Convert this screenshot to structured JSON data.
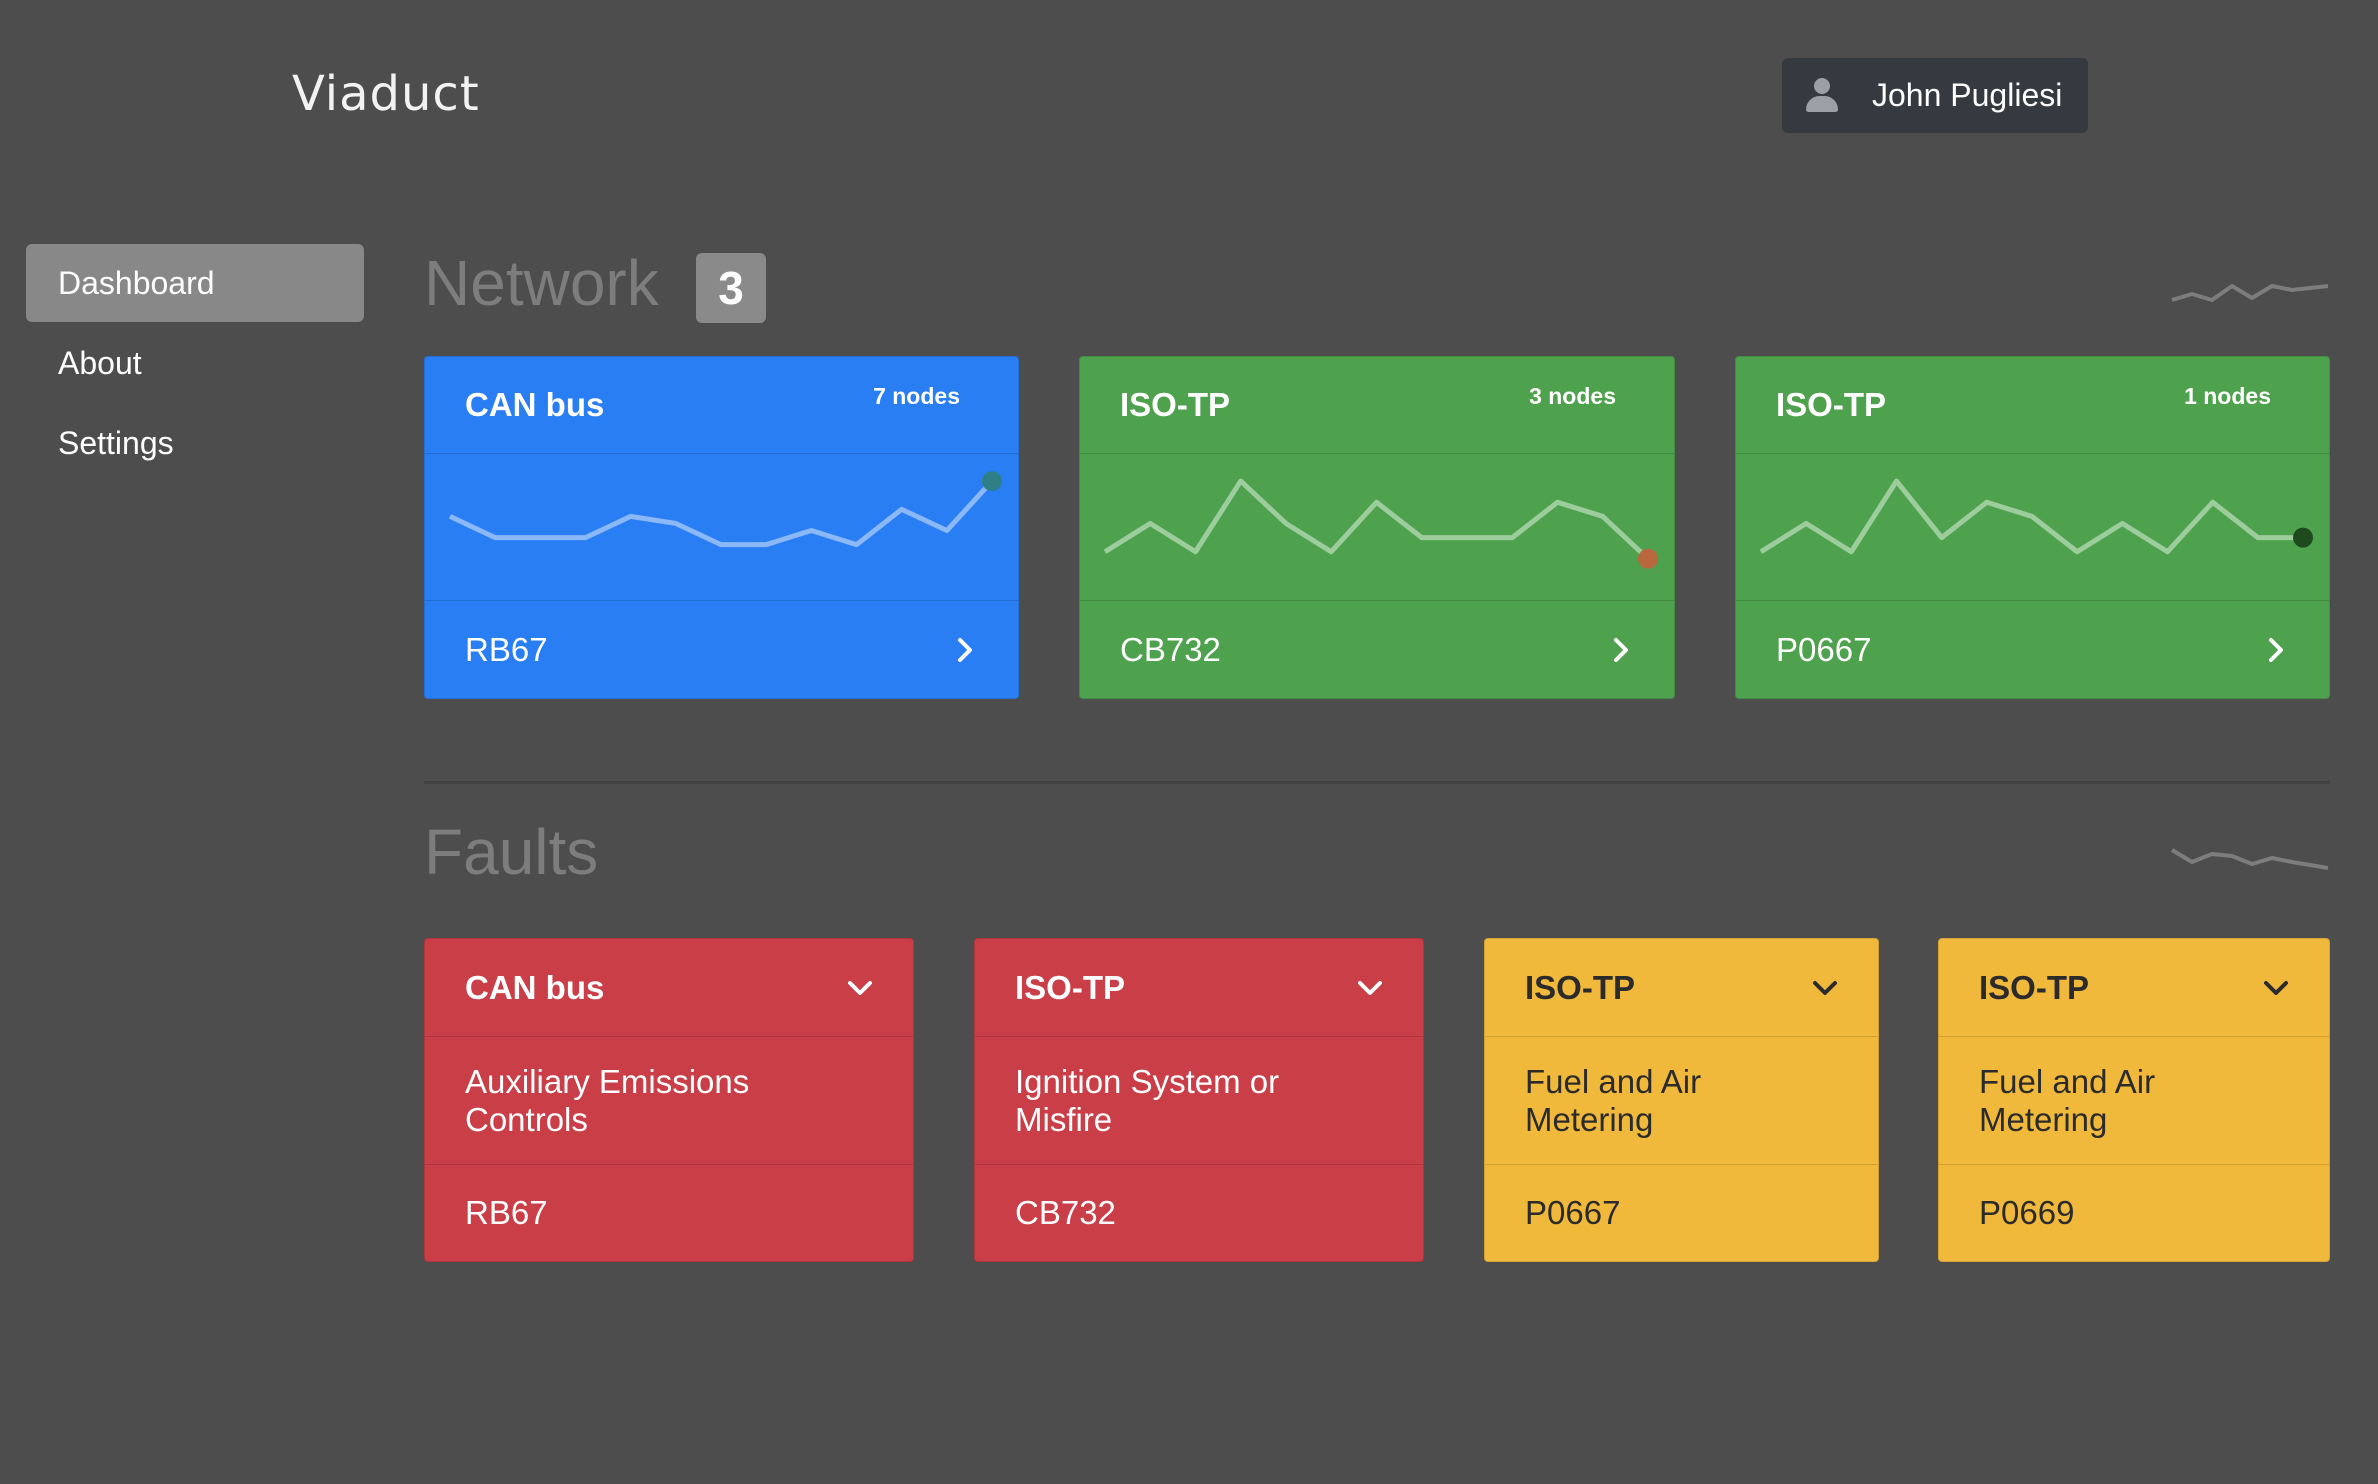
{
  "header": {
    "logo": "Viaduct",
    "user_name": "John Pugliesi"
  },
  "sidebar": {
    "items": [
      {
        "label": "Dashboard",
        "active": true
      },
      {
        "label": "About"
      },
      {
        "label": "Settings"
      }
    ]
  },
  "network": {
    "title": "Network",
    "count": "3",
    "cards": [
      {
        "title": "CAN bus",
        "nodes": "7 nodes",
        "code": "RB67",
        "color": "#2a7ef4",
        "end_dot_color": "#2f7f86",
        "spark": [
          9,
          6,
          6,
          6,
          9,
          8,
          5,
          5,
          7,
          5,
          10,
          7,
          14
        ]
      },
      {
        "title": "ISO-TP",
        "nodes": "3 nodes",
        "code": "CB732",
        "color": "#4ea24e",
        "end_dot_color": "#b8683c",
        "spark": [
          4,
          8,
          4,
          14,
          8,
          4,
          11,
          6,
          6,
          6,
          11,
          9,
          3
        ]
      },
      {
        "title": "ISO-TP",
        "nodes": "1 nodes",
        "code": "P0667",
        "color": "#4ea24e",
        "end_dot_color": "#1e4a1e",
        "spark": [
          4,
          8,
          4,
          14,
          6,
          11,
          9,
          4,
          8,
          4,
          11,
          6,
          6
        ]
      }
    ]
  },
  "faults": {
    "title": "Faults",
    "cards": [
      {
        "title": "CAN bus",
        "description": "Auxiliary Emissions Controls",
        "code": "RB67",
        "color": "#c93e47"
      },
      {
        "title": "ISO-TP",
        "description": "Ignition System or Misfire",
        "code": "CB732",
        "color": "#c93e47"
      },
      {
        "title": "ISO-TP",
        "description": "Fuel and Air Metering",
        "code": "P0667",
        "color": "#f0b93c"
      },
      {
        "title": "ISO-TP",
        "description": "Fuel and Air Metering",
        "code": "P0669",
        "color": "#f0b93c"
      }
    ]
  },
  "icons": {
    "user": "user-icon",
    "chevron_right": "chevron-right-icon",
    "chevron_down": "chevron-down-icon",
    "trend": "trend-line-icon"
  }
}
